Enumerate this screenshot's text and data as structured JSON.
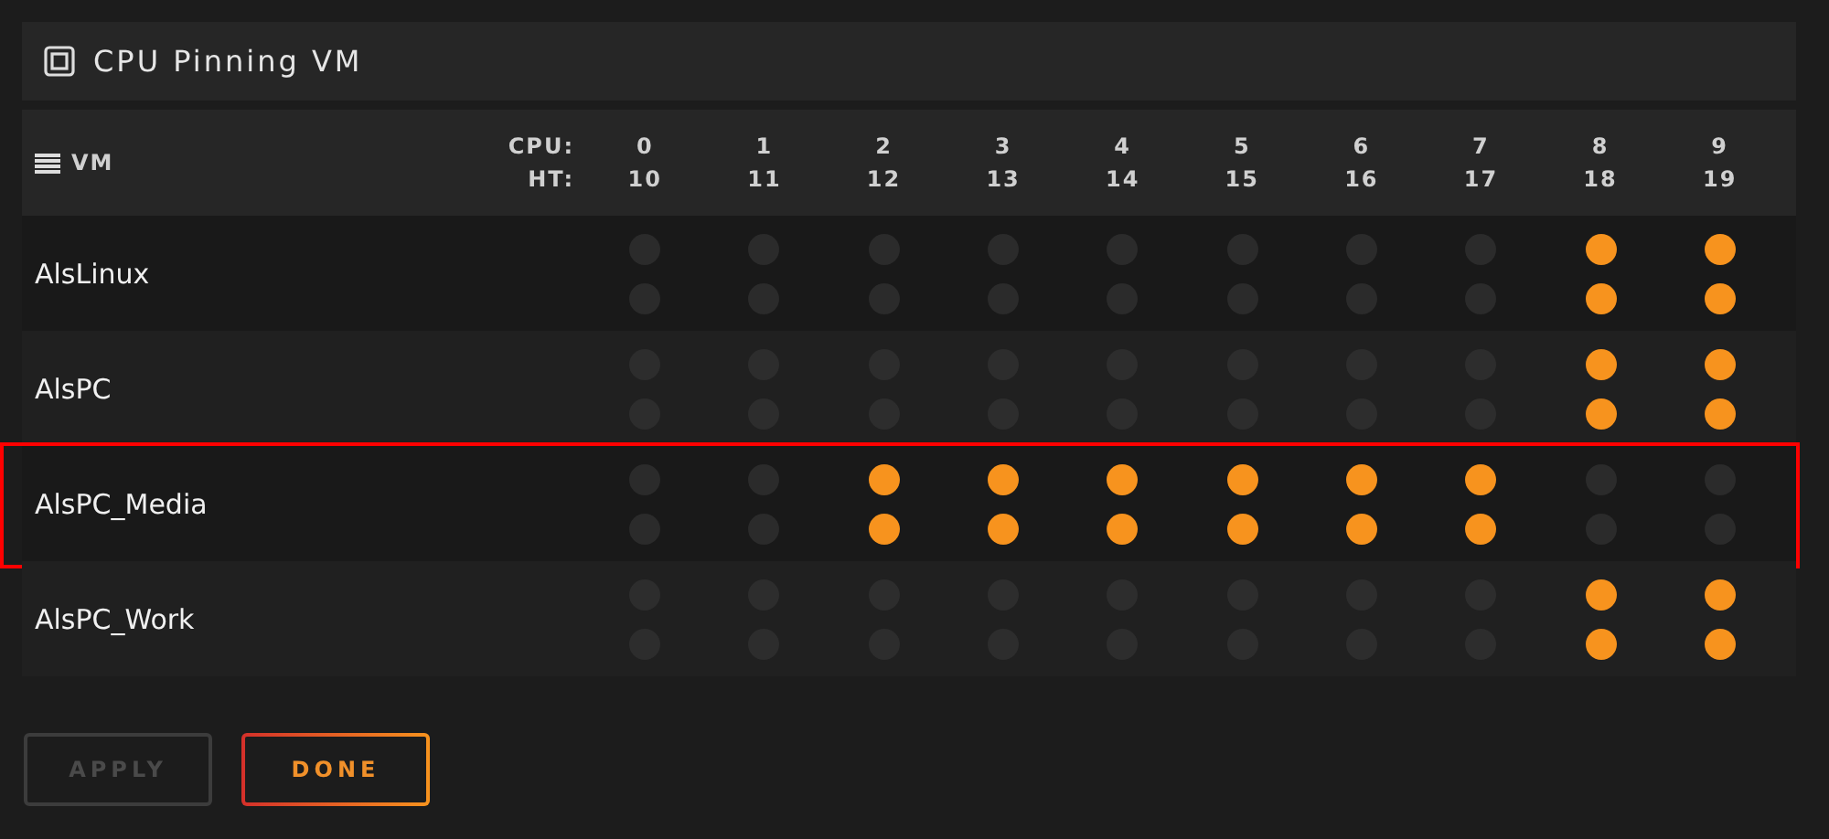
{
  "panel": {
    "title": "CPU Pinning VM"
  },
  "table": {
    "name_header": "VM",
    "cpu_label": "CPU:",
    "ht_label": "HT:",
    "cores": [
      {
        "cpu": "0",
        "ht": "10"
      },
      {
        "cpu": "1",
        "ht": "11"
      },
      {
        "cpu": "2",
        "ht": "12"
      },
      {
        "cpu": "3",
        "ht": "13"
      },
      {
        "cpu": "4",
        "ht": "14"
      },
      {
        "cpu": "5",
        "ht": "15"
      },
      {
        "cpu": "6",
        "ht": "16"
      },
      {
        "cpu": "7",
        "ht": "17"
      },
      {
        "cpu": "8",
        "ht": "18"
      },
      {
        "cpu": "9",
        "ht": "19"
      }
    ],
    "rows": [
      {
        "name": "AlsLinux",
        "highlighted": false,
        "cpu_pinned": [
          false,
          false,
          false,
          false,
          false,
          false,
          false,
          false,
          true,
          true
        ],
        "ht_pinned": [
          false,
          false,
          false,
          false,
          false,
          false,
          false,
          false,
          true,
          true
        ]
      },
      {
        "name": "AlsPC",
        "highlighted": false,
        "cpu_pinned": [
          false,
          false,
          false,
          false,
          false,
          false,
          false,
          false,
          true,
          true
        ],
        "ht_pinned": [
          false,
          false,
          false,
          false,
          false,
          false,
          false,
          false,
          true,
          true
        ]
      },
      {
        "name": "AlsPC_Media",
        "highlighted": true,
        "cpu_pinned": [
          false,
          false,
          true,
          true,
          true,
          true,
          true,
          true,
          false,
          false
        ],
        "ht_pinned": [
          false,
          false,
          true,
          true,
          true,
          true,
          true,
          true,
          false,
          false
        ]
      },
      {
        "name": "AlsPC_Work",
        "highlighted": false,
        "cpu_pinned": [
          false,
          false,
          false,
          false,
          false,
          false,
          false,
          false,
          true,
          true
        ],
        "ht_pinned": [
          false,
          false,
          false,
          false,
          false,
          false,
          false,
          false,
          true,
          true
        ]
      }
    ]
  },
  "buttons": [
    {
      "label": "APPLY",
      "disabled": true
    },
    {
      "label": "DONE",
      "disabled": false
    }
  ]
}
